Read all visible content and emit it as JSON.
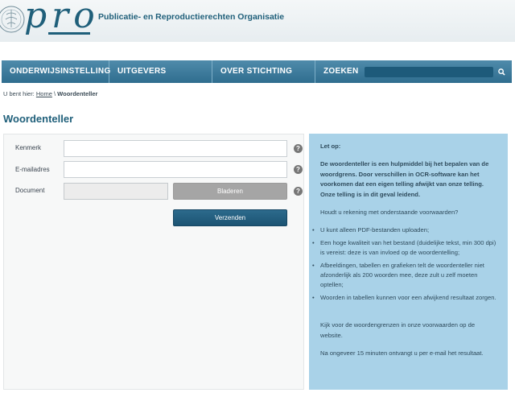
{
  "header": {
    "logo_text": "pro",
    "tagline": "Publicatie- en Reproductierechten Organisatie"
  },
  "nav": {
    "items": [
      {
        "label": "ONDERWIJSINSTELLING"
      },
      {
        "label": "UITGEVERS"
      },
      {
        "label": "OVER STICHTING PRO"
      },
      {
        "label": "ZOEKEN"
      }
    ],
    "search": {
      "placeholder": "",
      "value": ""
    },
    "search_icon": "search-icon"
  },
  "breadcrumb": {
    "prefix": "U bent hier:",
    "home": "Home",
    "separator": "\\",
    "current": "Woordenteller"
  },
  "page": {
    "title": "Woordenteller"
  },
  "form": {
    "kenmerk_label": "Kenmerk",
    "kenmerk_value": "",
    "email_label": "E-mailadres",
    "email_value": "",
    "document_label": "Document",
    "browse_label": "Bladeren",
    "submit_label": "Verzenden",
    "help_glyph": "?"
  },
  "info": {
    "heading": "Let op:",
    "intro": "De woordenteller is een hulpmiddel bij het bepalen van de woordgrens. Door verschillen in OCR-software kan het voorkomen dat een eigen telling afwijkt van onze telling. Onze telling is in dit geval leidend.",
    "conditions_lead": "Houdt u rekening met onderstaande voorwaarden?",
    "bullets": [
      "U kunt alleen PDF-bestanden uploaden;",
      "Een hoge kwaliteit van het bestand (duidelijke tekst, min 300 dpi) is vereist: deze is van invloed op de woordentelling;",
      "Afbeeldingen, tabellen en grafieken telt de woordenteller niet afzonderlijk als 200 woorden mee, deze zult u zelf moeten optellen;",
      "Woorden in tabellen kunnen voor een afwijkend resultaat zorgen."
    ],
    "limits_note": "Kijk voor de woordengrenzen in onze voorwaarden op de website.",
    "result_note": "Na ongeveer 15 minuten ontvangt u per e-mail het resultaat."
  },
  "colors": {
    "brand": "#1f5f7a",
    "nav": "#3a7a9c",
    "info_bg": "#a9d2e8",
    "submit": "#245f80"
  }
}
